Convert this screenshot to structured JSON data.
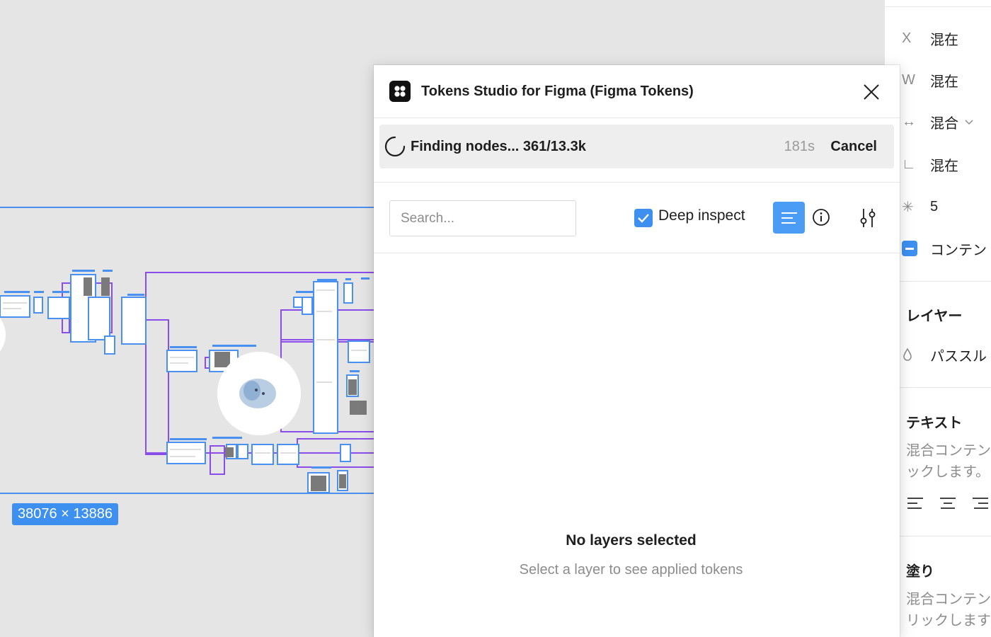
{
  "canvas": {
    "dimension_label": "38076 × 13886"
  },
  "plugin": {
    "title": "Tokens Studio for Figma (Figma Tokens)",
    "progress": {
      "status": "Finding nodes... 361/13.3k",
      "elapsed": "181s",
      "cancel_label": "Cancel"
    },
    "search": {
      "placeholder": "Search...",
      "value": ""
    },
    "deep_inspect": {
      "label": "Deep inspect",
      "checked": true
    },
    "empty_state": {
      "title": "No layers selected",
      "subtitle": "Select a layer to see applied tokens"
    },
    "colors": {
      "accent": "#3d8ff0"
    }
  },
  "properties_panel": {
    "rows": [
      {
        "icon": "X",
        "value": "混在"
      },
      {
        "icon": "W",
        "value": "混在"
      },
      {
        "icon": "↔",
        "value": "混合"
      },
      {
        "icon": "∟",
        "value": "混在"
      },
      {
        "icon": "✳",
        "value": "5"
      },
      {
        "icon": "fill-check-icon",
        "value": "コンテン"
      }
    ],
    "layer": {
      "title": "レイヤー",
      "blend_value": "パススル"
    },
    "text": {
      "title": "テキスト",
      "line1": "混合コンテン",
      "line2": "ックします。"
    },
    "fill": {
      "title": "塗り",
      "line1": "混合コンテン",
      "line2": "リックします"
    }
  }
}
